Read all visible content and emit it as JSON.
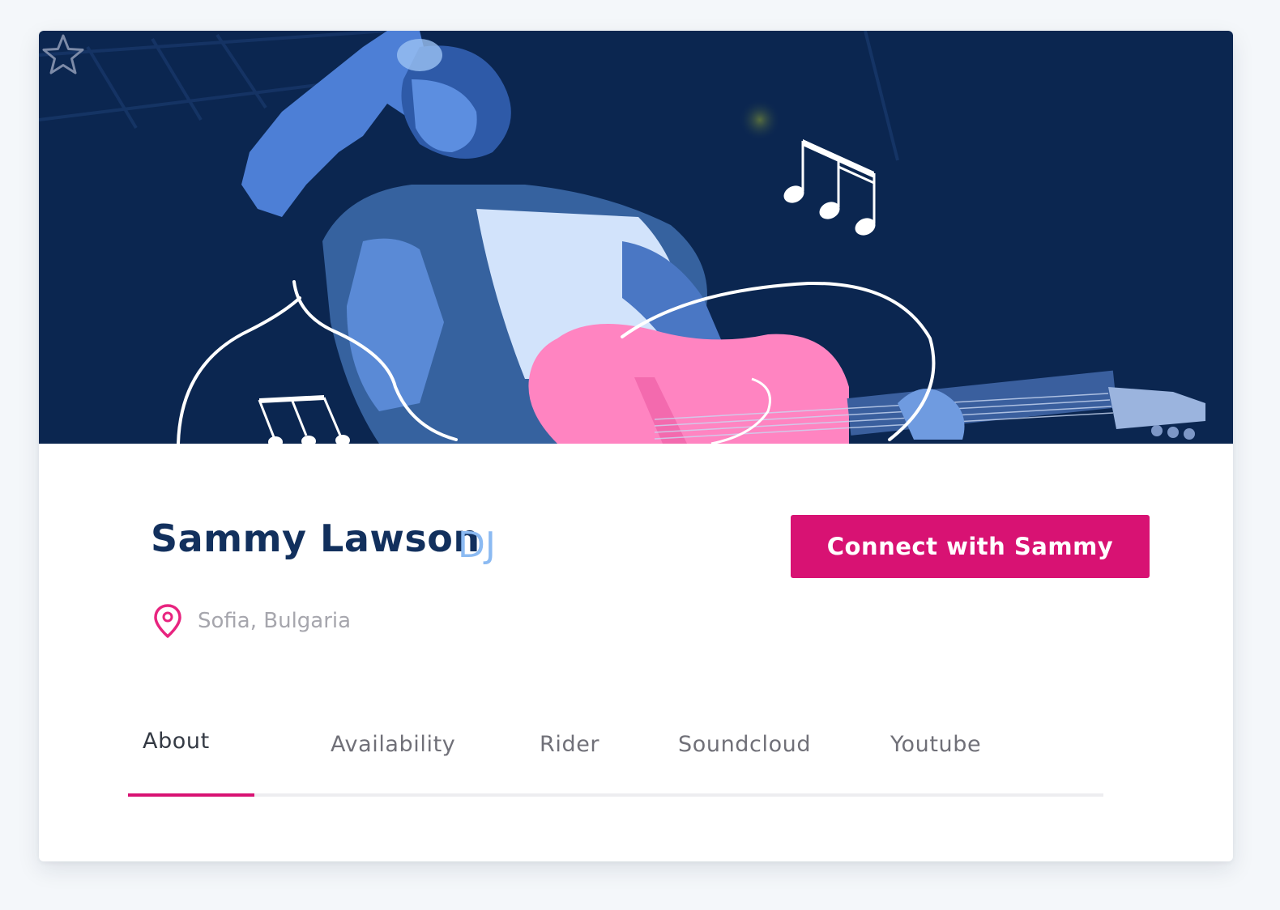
{
  "hero": {
    "favorite_icon": "star-outline-icon",
    "colors": {
      "background": "#0b2650",
      "accent_pink": "#ff84c1",
      "figure_blue": "#4d7fd6"
    }
  },
  "profile": {
    "name": "Sammy Lawson",
    "role": "DJ",
    "location_icon": "map-pin-icon",
    "location": "Sofia, Bulgaria"
  },
  "actions": {
    "connect_label": "Connect with Sammy"
  },
  "tabs": [
    {
      "label": "About",
      "active": true
    },
    {
      "label": "Availability",
      "active": false
    },
    {
      "label": "Rider",
      "active": false
    },
    {
      "label": "Soundcloud",
      "active": false
    },
    {
      "label": "Youtube",
      "active": false
    }
  ],
  "colors": {
    "primary": "#d81273",
    "name_text": "#12305d",
    "role_text": "#8bbaf2",
    "muted_text": "#a6a6ad"
  }
}
